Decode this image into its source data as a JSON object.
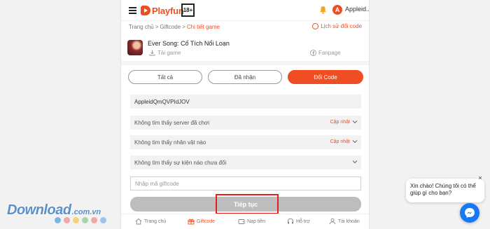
{
  "header": {
    "logo_text": "Playfun",
    "age_rating": "18+",
    "user_initial": "A",
    "user_name": "Appleid..."
  },
  "breadcrumb": {
    "home": "Trang chủ",
    "sep1": ">",
    "giftcode": "Giftcode",
    "sep2": ">",
    "current": "Chi tiết game",
    "history_link": "Lịch sử đổi code"
  },
  "game": {
    "title": "Ever Song: Cổ Tích Nổi Loạn",
    "download_label": "Tải game",
    "fanpage_label": "Fanpage"
  },
  "tabs": [
    "Tất cả",
    "Đã nhận",
    "Đổi Code"
  ],
  "form": {
    "account_value": "AppleidQmQVPIdJOV",
    "server_text": "Không tìm thấy server đã chơi",
    "server_update": "Cập nhật",
    "character_text": "Không tìm thấy nhân vật nào",
    "character_update": "Cập nhật",
    "event_text": "Không tìm thấy sự kiện nào chưa đổi",
    "giftcode_placeholder": "Nhập mã giftcode",
    "continue_label": "Tiếp tục"
  },
  "bottom_nav": [
    "Trang chủ",
    "Giftcode",
    "Nạp tiền",
    "Hỗ trợ",
    "Tài khoản"
  ],
  "watermark": {
    "main": "Download",
    "sub": ".com.vn",
    "dot_colors": [
      "#7fb3e0",
      "#f2a6a6",
      "#f5d37a",
      "#a5d6a7",
      "#f2a6a6",
      "#9ec3e8"
    ]
  },
  "chat": {
    "greeting": "Xin chào! Chúng tôi có thể giúp gì cho bạn?",
    "close": "×"
  },
  "colors": {
    "accent": "#ef4e23",
    "messenger": "#1877f2",
    "highlight": "#e41d1d"
  }
}
